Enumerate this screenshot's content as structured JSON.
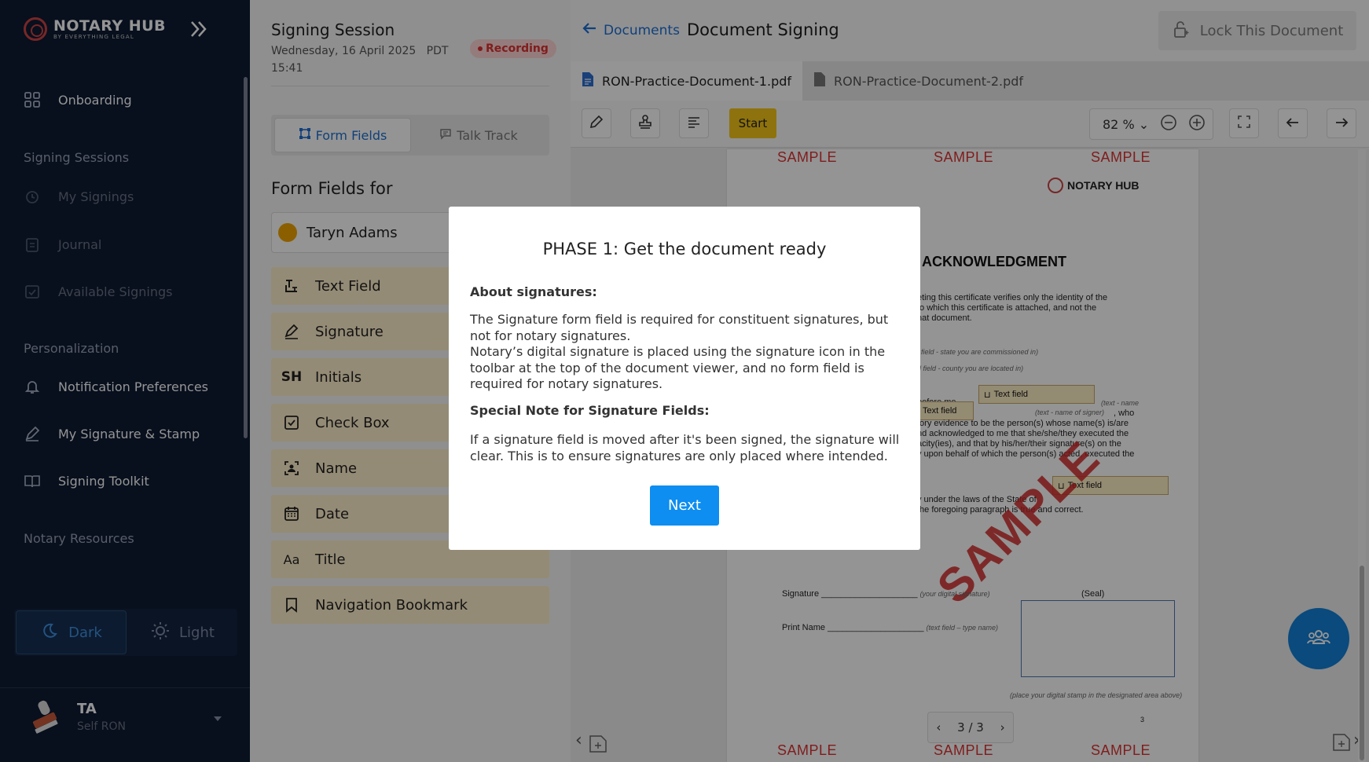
{
  "sidebar": {
    "logo_title": "NOTARY HUB",
    "logo_subtitle": "BY EVERYTHING LEGAL",
    "onboarding": "Onboarding",
    "section_signing": "Signing Sessions",
    "my_signings": "My Signings",
    "journal": "Journal",
    "available_signings": "Available Signings",
    "section_personalization": "Personalization",
    "notification_prefs": "Notification Preferences",
    "signature_stamp": "My Signature & Stamp",
    "signing_toolkit": "Signing Toolkit",
    "section_resources": "Notary Resources",
    "theme_dark": "Dark",
    "theme_light": "Light",
    "user_initials": "TA",
    "user_role": "Self RON"
  },
  "session": {
    "title": "Signing Session",
    "date": "Wednesday, 16 April 2025",
    "tz": "PDT",
    "time": "15:41",
    "recording": "Recording"
  },
  "tabs": {
    "form_fields": "Form Fields",
    "talk_track": "Talk Track"
  },
  "form_fields": {
    "title": "Form Fields for",
    "signer": "Taryn Adams",
    "items": [
      "Text Field",
      "Signature",
      "Initials",
      "Check Box",
      "Name",
      "Date",
      "Title",
      "Navigation Bookmark"
    ]
  },
  "document": {
    "back": "Documents",
    "title": "Document Signing",
    "lock": "Lock This Document",
    "file1": "RON-Practice-Document-1.pdf",
    "file2": "RON-Practice-Document-2.pdf",
    "start": "Start",
    "zoom": "82 %",
    "page_indicator": "3 / 3"
  },
  "page": {
    "sample": "SAMPLE",
    "logo": "NOTARY HUB",
    "heading": "ACKNOWLEDGMENT",
    "p1": "eting this certificate verifies only the identity of the",
    "p2": "to which this certificate is attached, and not the",
    "p3": "hat document.",
    "state_hint": "t field - state you are commissioned in)",
    "county_hint": "d field - county you are located in)",
    "text_field": "Text field",
    "before_me": "before me,",
    "name_hint": "(text - name",
    "signer_hint": "(text - name of signer)",
    "who": ", who",
    "p4": "tory evidence to be the person(s) whose name(s) is/are",
    "p5": "nd acknowledged to me that she/she/they executed the",
    "p6": "acity(ies), and that by his/her/their signature(s) on the",
    "p7": "y upon behalf of which the person(s) acted, executed the",
    "p8": "y under the laws of the State of",
    "p9": "the foregoing paragraph is true and correct.",
    "sig_label": "Signature",
    "sig_hint": "(your digital signature)",
    "seal": "(Seal)",
    "print_label": "Print Name",
    "print_hint": "(text field – type name)",
    "stamp_hint": "(place your digital stamp in the designated area above)",
    "page_num": "3",
    "watermark": "SAMPLE"
  },
  "modal": {
    "title": "PHASE 1: Get the document ready",
    "about_label": "About signatures:",
    "about_body1": "The Signature form field is required for constituent signatures, but not for notary signatures.",
    "about_body2": "Notary’s digital signature is placed using the signature icon in the toolbar at the top of the document viewer, and no form field is required for notary signatures.",
    "note_label": "Special Note for Signature Fields:",
    "note_body": "If a signature field is moved after it's been signed, the signature will clear. This is to ensure signatures are only placed where intended.",
    "next": "Next"
  }
}
